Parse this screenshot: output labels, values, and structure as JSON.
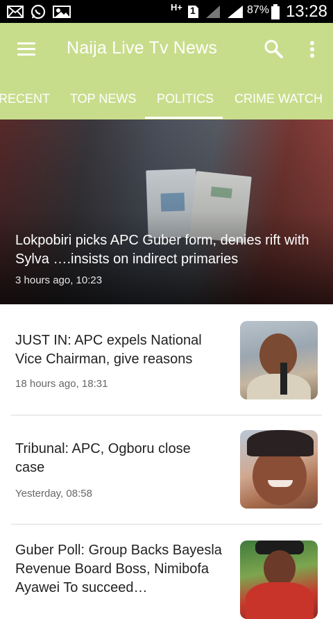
{
  "status_bar": {
    "battery_percent": "87%",
    "time": "13:28",
    "network_label": "H+",
    "sim_label": "1",
    "icons": [
      "email-icon",
      "whatsapp-icon",
      "photo-icon",
      "network-icon",
      "sim-icon",
      "no-signal-icon",
      "signal-icon",
      "battery-icon"
    ]
  },
  "app_bar": {
    "title": "Naija Live Tv News",
    "color": "#c8dd8c",
    "icons": [
      "menu-icon",
      "search-icon",
      "more-vert-icon"
    ]
  },
  "tabs": [
    {
      "label": "RECENT",
      "selected": false
    },
    {
      "label": "TOP NEWS",
      "selected": false
    },
    {
      "label": "POLITICS",
      "selected": true
    },
    {
      "label": "CRIME WATCH",
      "selected": false
    }
  ],
  "featured": {
    "title": "Lokpobiri picks APC Guber form, denies rift with Sylva ….insists on indirect primaries",
    "time": "3 hours ago, 10:23"
  },
  "articles": [
    {
      "title": "JUST IN: APC expels National Vice Chairman, give reasons",
      "time": "18 hours ago, 18:31"
    },
    {
      "title": "Tribunal: APC, Ogboru close case",
      "time": "Yesterday, 08:58"
    },
    {
      "title": "Guber Poll: Group Backs Bayesla Revenue Board Boss, Nimibofa Ayawei To succeed…",
      "time": ""
    }
  ]
}
